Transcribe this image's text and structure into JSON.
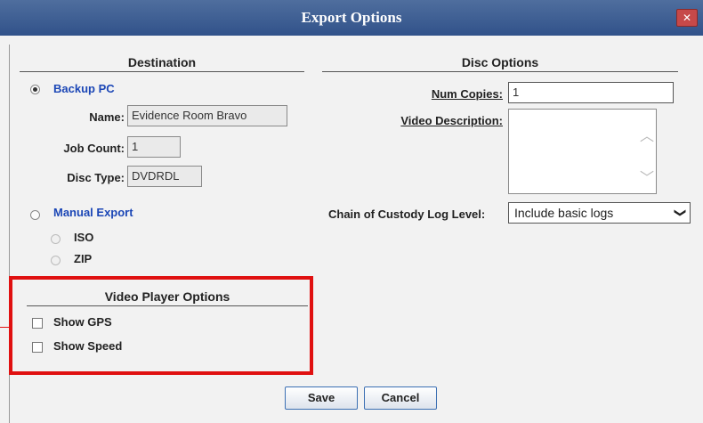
{
  "dialog": {
    "title": "Export Options",
    "close_glyph": "✕"
  },
  "destination": {
    "heading": "Destination",
    "backup_pc": {
      "label": "Backup PC",
      "selected": true
    },
    "name": {
      "label": "Name:",
      "value": "Evidence Room Bravo"
    },
    "job_count": {
      "label": "Job Count:",
      "value": "1"
    },
    "disc_type": {
      "label": "Disc Type:",
      "value": "DVDRDL"
    },
    "manual_export": {
      "label": "Manual Export",
      "selected": false
    },
    "iso": {
      "label": "ISO"
    },
    "zip": {
      "label": "ZIP"
    }
  },
  "disc_options": {
    "heading": "Disc Options",
    "num_copies": {
      "label": "Num Copies:",
      "value": "1"
    },
    "video_description": {
      "label": "Video Description:",
      "value": ""
    },
    "chain_of_custody": {
      "label": "Chain of Custody Log Level:",
      "value": "Include basic logs"
    }
  },
  "video_player_options": {
    "heading": "Video Player Options",
    "show_gps": {
      "label": "Show GPS",
      "checked": false
    },
    "show_speed": {
      "label": "Show Speed",
      "checked": false
    }
  },
  "footer": {
    "save_label": "Save",
    "cancel_label": "Cancel"
  },
  "colors": {
    "title_bar": "#3a5a90",
    "link_blue": "#1c47b6",
    "highlight_red": "#e01010",
    "dialog_bg": "#f2f2f2"
  },
  "icons": {
    "close": "close-icon",
    "dropdown": "chevron-down-icon",
    "scroll_up": "chevron-up-icon",
    "scroll_down": "chevron-down-icon"
  }
}
